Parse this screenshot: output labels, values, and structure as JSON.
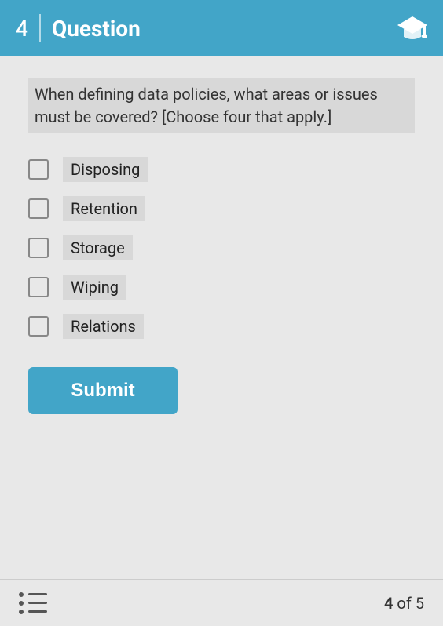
{
  "header": {
    "number": "4",
    "divider": true,
    "title": "Question",
    "icon_label": "graduation-cap-icon"
  },
  "question": {
    "text": "When defining data policies, what areas or issues must be covered? [Choose four that apply.]"
  },
  "options": [
    {
      "id": "opt1",
      "label": "Disposing",
      "checked": false
    },
    {
      "id": "opt2",
      "label": "Retention",
      "checked": false
    },
    {
      "id": "opt3",
      "label": "Storage",
      "checked": false
    },
    {
      "id": "opt4",
      "label": "Wiping",
      "checked": false
    },
    {
      "id": "opt5",
      "label": "Relations",
      "checked": false
    }
  ],
  "submit": {
    "label": "Submit"
  },
  "footer": {
    "pagination": " of 5",
    "current_page": "4"
  }
}
